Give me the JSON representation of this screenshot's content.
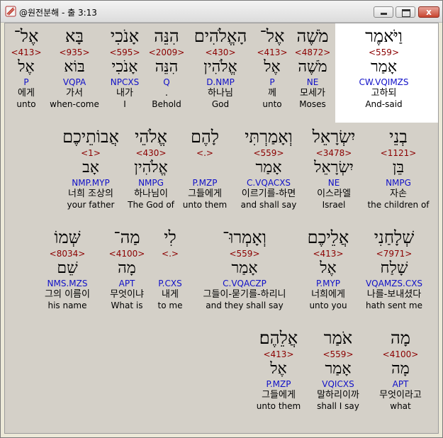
{
  "window": {
    "title": "@원전분해 - 출 3:13",
    "close_label": "x"
  },
  "rows": [
    [
      {
        "heb": "אֶל־",
        "strong": "<413>",
        "root": "אֶל",
        "parse": "P",
        "kor": "에게",
        "eng": "unto"
      },
      {
        "heb": "בָּא",
        "strong": "<935>",
        "root": "בּוֹא",
        "parse": "VQPA",
        "kor": "가서",
        "eng": "when-come"
      },
      {
        "heb": "אָנֹכִי",
        "strong": "<595>",
        "root": "אָנֹכִי",
        "parse": "NPCXS",
        "kor": "내가",
        "eng": "I"
      },
      {
        "heb": "הִנֵּה",
        "strong": "<2009>",
        "root": "הִנֵּה",
        "parse": "Q",
        "kor": ".",
        "eng": "Behold"
      },
      {
        "heb": "הָאֱלֹהִים",
        "strong": "<430>",
        "root": "אֱלֹהִין",
        "parse": "D.NMP",
        "kor": "하나님",
        "eng": "God"
      },
      {
        "heb": "אֶל־",
        "strong": "<413>",
        "root": "אֶל",
        "parse": "P",
        "kor": "께",
        "eng": "unto"
      },
      {
        "heb": "מֹשֶׁה",
        "strong": "<4872>",
        "root": "מֹשֶׁה",
        "parse": "NE",
        "kor": "모세가",
        "eng": "Moses"
      },
      {
        "heb": "וַיֹּאמֶר",
        "strong": "<559>",
        "root": "אָמַר",
        "parse": "CW.VQIMZS",
        "kor": "고하되",
        "eng": "And-said"
      }
    ],
    [
      {
        "heb": "אֲבוֹתֵיכֶם",
        "strong": "<1>",
        "root": "אָב",
        "parse": "NMP.MYP",
        "kor": "너희 조상의",
        "eng": "your father"
      },
      {
        "heb": "אֱלֹהֵי",
        "strong": "<430>",
        "root": "אֱלֹהִין",
        "parse": "NMPG",
        "kor": "하나님이",
        "eng": "The God of"
      },
      {
        "heb": "לָהֶם",
        "strong": "<.>",
        "root": "",
        "parse": "P.MZP",
        "kor": "그들에게",
        "eng": "unto them"
      },
      {
        "heb": "וְאָמַרְתִּי",
        "strong": "<559>",
        "root": "אָמַר",
        "parse": "C.VQACXS",
        "kor": "이르기를-하면",
        "eng": "and shall say"
      },
      {
        "heb": "יִשְׂרָאֵל",
        "strong": "<3478>",
        "root": "יִשְׂרָאֵל",
        "parse": "NE",
        "kor": "이스라엘",
        "eng": "Israel"
      },
      {
        "heb": "בְנֵי",
        "strong": "<1121>",
        "root": "בֵּן",
        "parse": "NMPG",
        "kor": "자손",
        "eng": "the children of"
      }
    ],
    [
      {
        "heb": "שְּׁמוֹ",
        "strong": "<8034>",
        "root": "שֵׁם",
        "parse": "NMS.MZS",
        "kor": "그의 이름이",
        "eng": "his name"
      },
      {
        "heb": "מַה־",
        "strong": "<4100>",
        "root": "מָה",
        "parse": "APT",
        "kor": "무엇이냐",
        "eng": "What is"
      },
      {
        "heb": "לִי",
        "strong": "<.>",
        "root": "",
        "parse": "P.CXS",
        "kor": "내게",
        "eng": "to me"
      },
      {
        "heb": "וְאָמְרוּ־",
        "strong": "<559>",
        "root": "אָמַר",
        "parse": "C.VQACZP",
        "kor": "그들이-묻기를-하리니",
        "eng": "and they shall say"
      },
      {
        "heb": "אֲלֵיכֶם",
        "strong": "<413>",
        "root": "אֶל",
        "parse": "P.MYP",
        "kor": "너희에게",
        "eng": "unto you"
      },
      {
        "heb": "שְׁלָחַנִי",
        "strong": "<7971>",
        "root": "שָׁלַח",
        "parse": "VQAMZS.CXS",
        "kor": "나를-보내셨다",
        "eng": "hath sent me"
      }
    ],
    [
      {
        "heb": "אֲלֵהֶם׃",
        "strong": "<413>",
        "root": "אֶל",
        "parse": "P.MZP",
        "kor": "그들에게",
        "eng": "unto them"
      },
      {
        "heb": "אֹמַר",
        "strong": "<559>",
        "root": "אָמַר",
        "parse": "VQICXS",
        "kor": "말하리이까",
        "eng": "shall I say"
      },
      {
        "heb": "מָה",
        "strong": "<4100>",
        "root": "מָה",
        "parse": "APT",
        "kor": "무엇이라고",
        "eng": "what"
      }
    ]
  ]
}
